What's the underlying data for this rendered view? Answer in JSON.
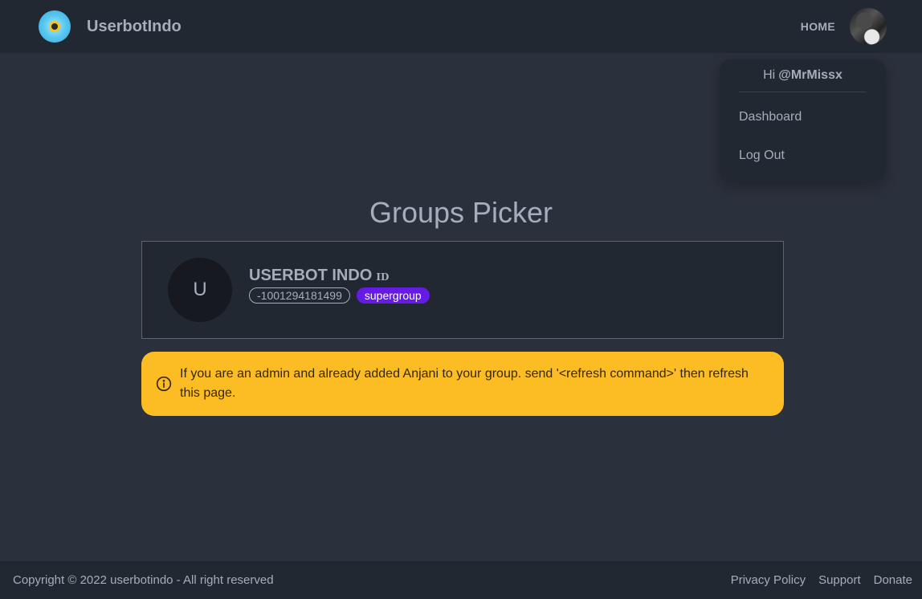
{
  "navbar": {
    "brand_name": "UserbotIndo",
    "logo_icon": "bee-logo-icon",
    "home_label": "HOME",
    "avatar_icon": "user-avatar"
  },
  "dropdown": {
    "greeting_prefix": "Hi",
    "username": "@MrMissx",
    "items": [
      {
        "label": "Dashboard"
      },
      {
        "label": "Log Out"
      }
    ]
  },
  "main": {
    "title": "Groups Picker",
    "groups": [
      {
        "avatar_letter": "U",
        "name": "USERBOT INDO",
        "id_label": "ID",
        "chat_id": "-1001294181499",
        "type": "supergroup"
      }
    ],
    "alert": {
      "icon": "info-icon",
      "text": "If you are an admin and already added Anjani to your group. send '<refresh command>' then refresh this page."
    }
  },
  "footer": {
    "copyright": "Copyright © 2022 userbotindo - All right reserved",
    "links": [
      {
        "label": "Privacy Policy"
      },
      {
        "label": "Support"
      },
      {
        "label": "Donate"
      }
    ]
  },
  "colors": {
    "background": "#2a303c",
    "surface": "#222831",
    "text": "#a6adbb",
    "badge_supergroup": "#661ae6",
    "alert_warning": "#fbbd23"
  }
}
